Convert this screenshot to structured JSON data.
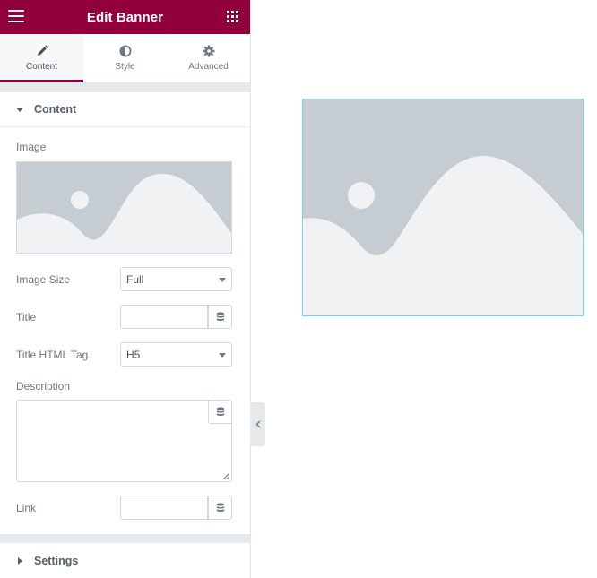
{
  "header": {
    "title": "Edit Banner",
    "menu_icon": "hamburger-icon",
    "apps_icon": "grid-icon",
    "color": "#92003b"
  },
  "tabs": [
    {
      "label": "Content",
      "icon": "pencil-icon",
      "active": true
    },
    {
      "label": "Style",
      "icon": "half-circle-icon",
      "active": false
    },
    {
      "label": "Advanced",
      "icon": "gear-icon",
      "active": false
    }
  ],
  "content_section": {
    "title": "Content",
    "image_label": "Image",
    "image_size": {
      "label": "Image Size",
      "value": "Full"
    },
    "title_field": {
      "label": "Title",
      "value": ""
    },
    "title_tag": {
      "label": "Title HTML Tag",
      "value": "H5"
    },
    "description": {
      "label": "Description",
      "value": ""
    },
    "link": {
      "label": "Link",
      "value": ""
    }
  },
  "settings_section": {
    "title": "Settings"
  },
  "preview": {
    "image": "placeholder-image",
    "selection_color": "#71d7f7"
  }
}
